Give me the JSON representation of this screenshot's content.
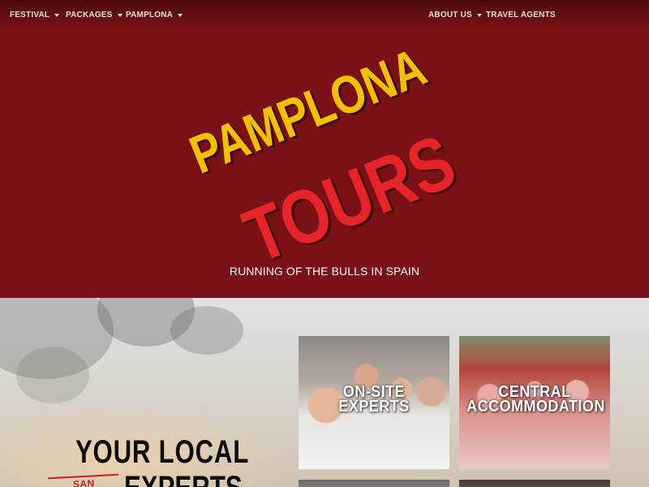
{
  "nav": {
    "left": [
      {
        "label": "FESTIVAL",
        "has_dropdown": true
      },
      {
        "label": "PACKAGES",
        "has_dropdown": true
      },
      {
        "label": "PAMPLONA",
        "has_dropdown": true
      }
    ],
    "right": [
      {
        "label": "ABOUT US",
        "has_dropdown": true
      },
      {
        "label": "TRAVEL AGENTS",
        "has_dropdown": false
      }
    ]
  },
  "hero": {
    "logo_line1": "PAMPLONA",
    "logo_line2": "TOURS",
    "tagline": "RUNNING OF THE BULLS IN SPAIN"
  },
  "section": {
    "heading_line1": "YOUR LOCAL",
    "badge": "SAN FERMIN",
    "heading_line2": "EXPERTS"
  },
  "cards": [
    {
      "title_line1": "ON-SITE",
      "title_line2": "EXPERTS",
      "icon": "team-photo"
    },
    {
      "title_line1": "CENTRAL",
      "title_line2": "ACCOMMODATION",
      "icon": "festival-crowd-photo"
    },
    {
      "title_line1": "",
      "title_line2": "",
      "icon": "photo"
    },
    {
      "title_line1": "",
      "title_line2": "",
      "icon": "photo"
    }
  ],
  "colors": {
    "hero_background": "#7a1116",
    "logo_yellow": "#f1c100",
    "logo_red": "#e8242b",
    "accent_red": "#c81e24",
    "heading_text": "#0d0d0d"
  }
}
